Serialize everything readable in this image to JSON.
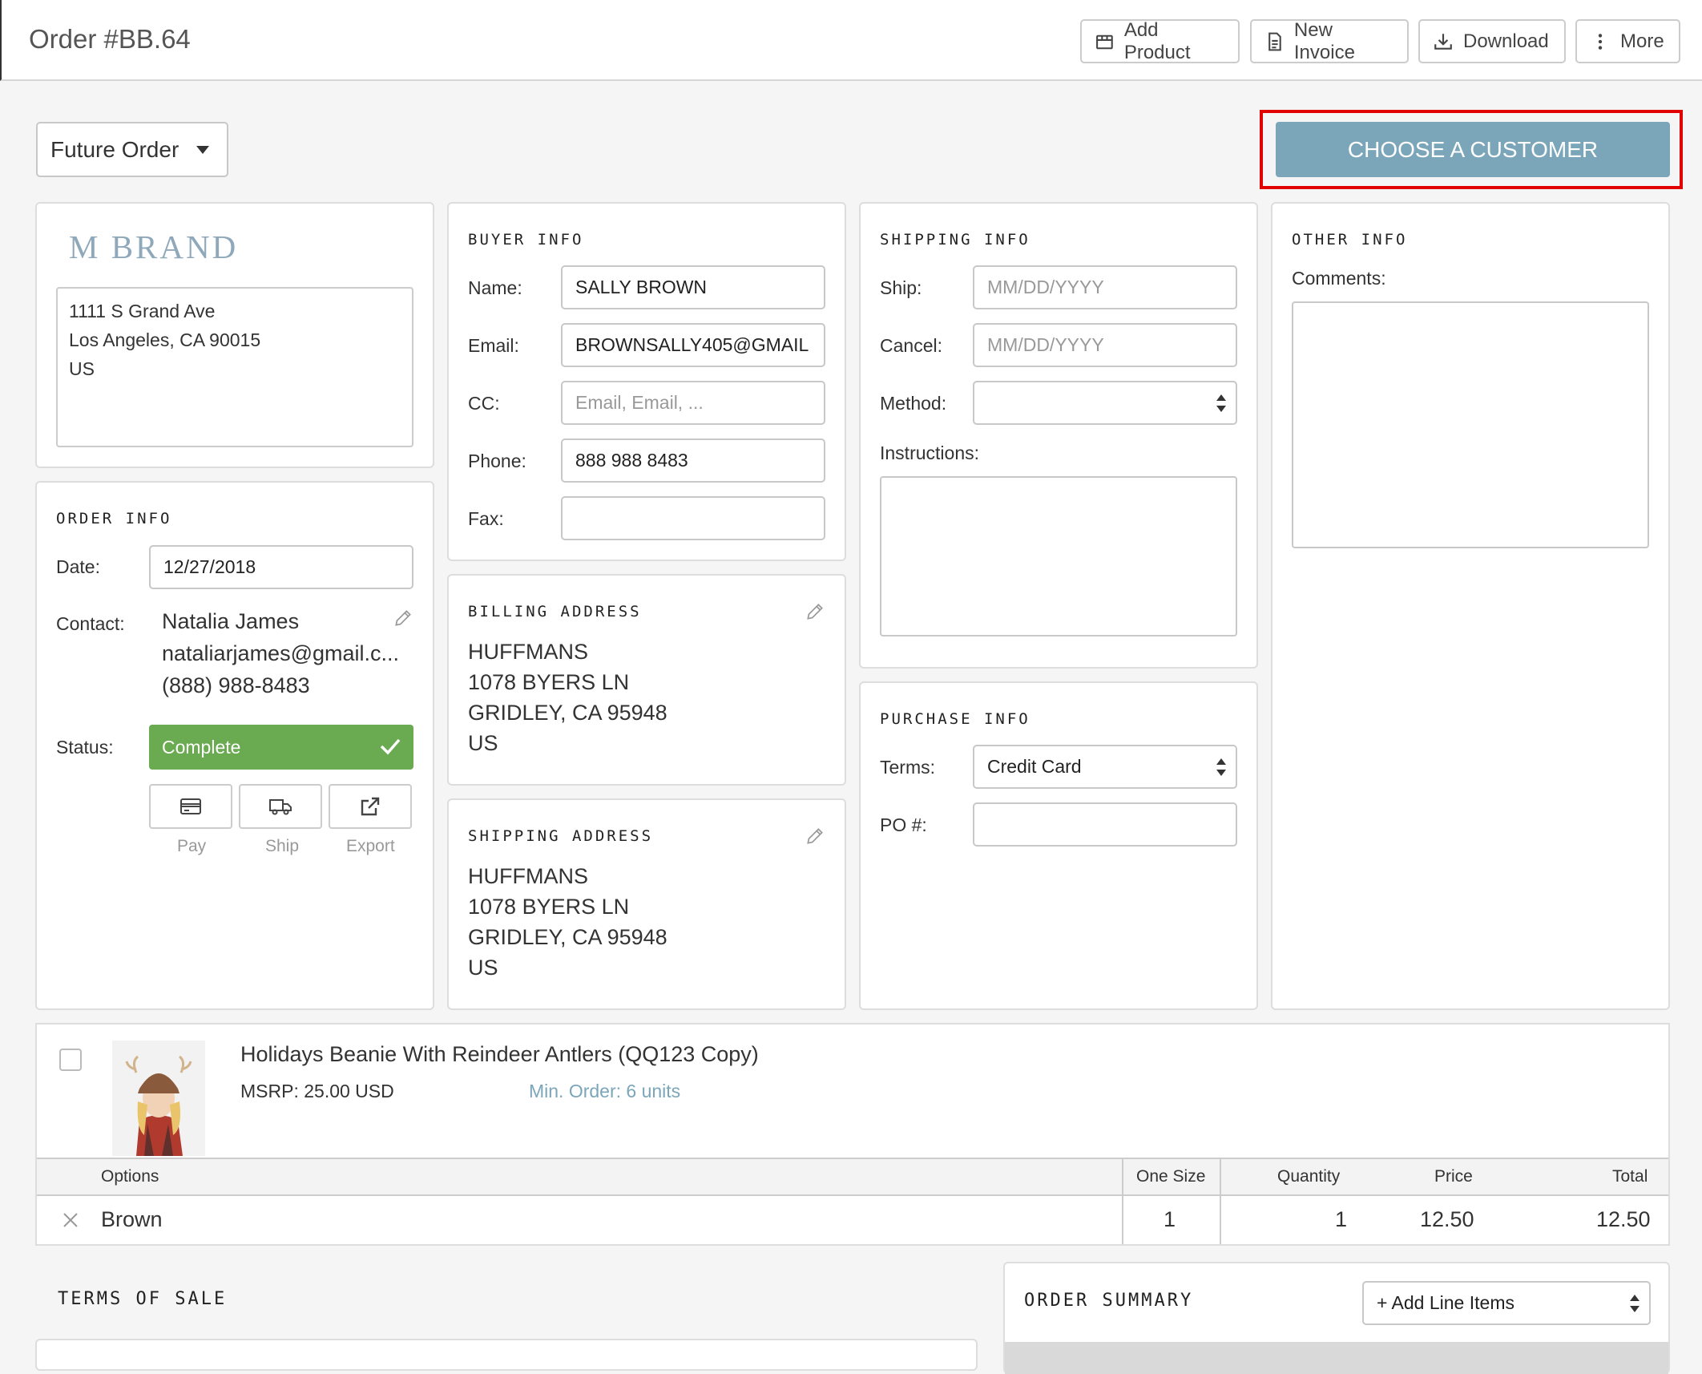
{
  "header": {
    "title": "Order #BB.64",
    "buttons": {
      "add_product": "Add Product",
      "new_invoice": "New Invoice",
      "download": "Download",
      "more": "More"
    }
  },
  "order_type": {
    "selected": "Future Order"
  },
  "choose_customer": {
    "label": "CHOOSE A CUSTOMER",
    "color": "#7ba6ba",
    "highlight": "#e00000"
  },
  "brand": {
    "logo_text": "M BRAND",
    "address_lines": [
      "1111 S Grand Ave",
      "Los Angeles, CA 90015",
      "US"
    ]
  },
  "buyer_info": {
    "title": "BUYER INFO",
    "name_label": "Name:",
    "name_value": "SALLY BROWN",
    "email_label": "Email:",
    "email_value": "BROWNSALLY405@GMAIL",
    "cc_label": "CC:",
    "cc_placeholder": "Email, Email, ...",
    "phone_label": "Phone:",
    "phone_value": "888 988 8483",
    "fax_label": "Fax:",
    "fax_value": ""
  },
  "shipping_info": {
    "title": "SHIPPING INFO",
    "ship_label": "Ship:",
    "ship_placeholder": "MM/DD/YYYY",
    "cancel_label": "Cancel:",
    "cancel_placeholder": "MM/DD/YYYY",
    "method_label": "Method:",
    "method_value": "",
    "instructions_label": "Instructions:"
  },
  "other_info": {
    "title": "OTHER INFO",
    "comments_label": "Comments:"
  },
  "order_info": {
    "title": "ORDER INFO",
    "date_label": "Date:",
    "date_value": "12/27/2018",
    "contact_label": "Contact:",
    "contact_name": "Natalia James",
    "contact_email": "nataliarjames@gmail.c...",
    "contact_phone": "(888) 988-8483",
    "status_label": "Status:",
    "status_value": "Complete",
    "status_color": "#6aaa50",
    "actions": {
      "pay": "Pay",
      "ship": "Ship",
      "export": "Export"
    }
  },
  "billing_address": {
    "title": "BILLING ADDRESS",
    "lines": [
      "HUFFMANS",
      "1078 BYERS LN",
      "GRIDLEY, CA 95948",
      "US"
    ]
  },
  "shipping_address": {
    "title": "SHIPPING ADDRESS",
    "lines": [
      "HUFFMANS",
      "1078 BYERS LN",
      "GRIDLEY, CA 95948",
      "US"
    ]
  },
  "purchase_info": {
    "title": "PURCHASE INFO",
    "terms_label": "Terms:",
    "terms_value": "Credit Card",
    "po_label": "PO #:",
    "po_value": ""
  },
  "product": {
    "name": "Holidays Beanie With Reindeer Antlers (QQ123 Copy)",
    "msrp": "MSRP: 25.00 USD",
    "min_order": "Min. Order: 6 units",
    "table": {
      "headers": {
        "options": "Options",
        "one_size": "One Size",
        "quantity": "Quantity",
        "price": "Price",
        "total": "Total"
      },
      "row": {
        "option": "Brown",
        "one_size": "1",
        "quantity": "1",
        "price": "12.50",
        "total": "12.50"
      }
    }
  },
  "terms_of_sale": {
    "title": "TERMS OF SALE"
  },
  "order_summary": {
    "title": "ORDER SUMMARY",
    "add_line_items": "+ Add Line Items"
  }
}
